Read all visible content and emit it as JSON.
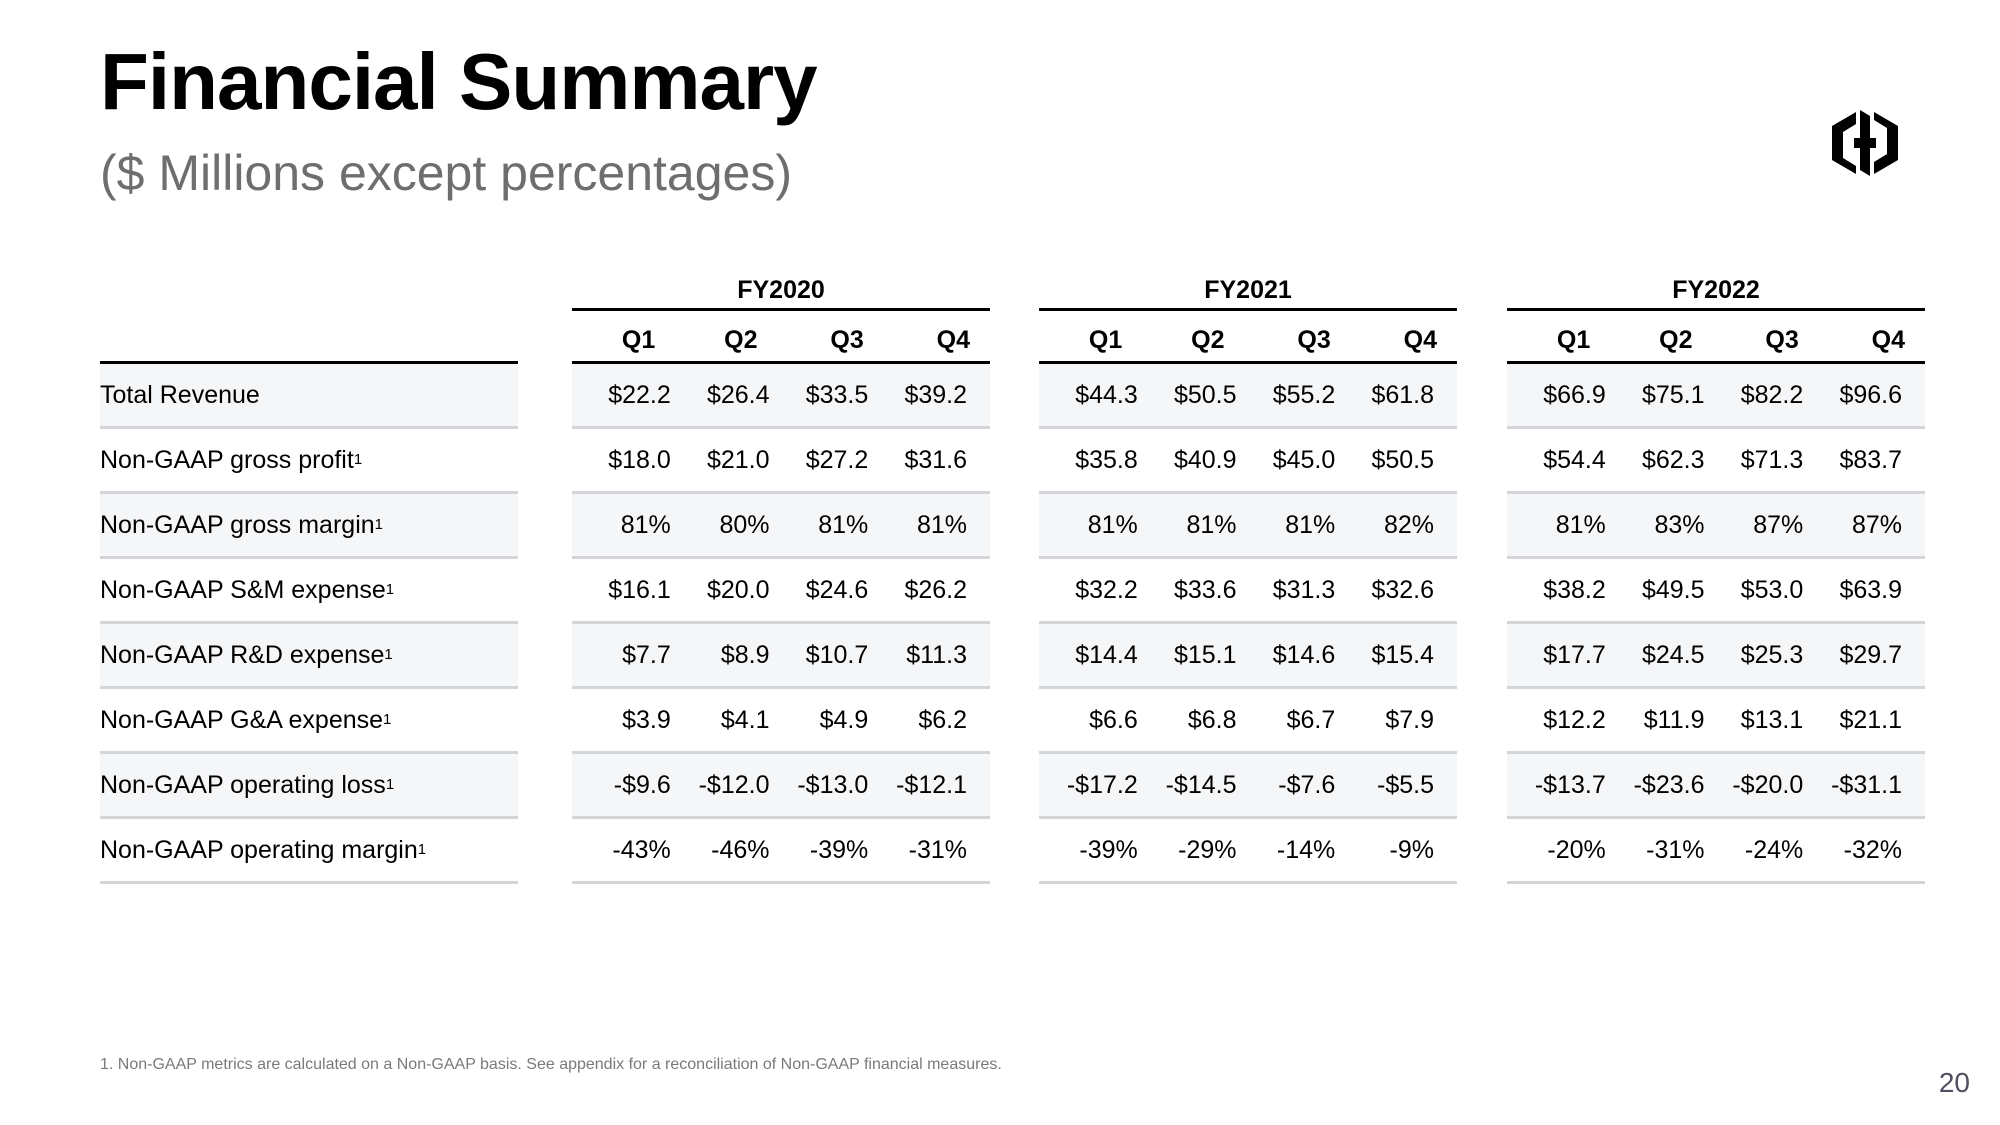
{
  "header": {
    "title": "Financial Summary",
    "subtitle": "($ Millions except percentages)",
    "logo": "hashicorp-logo-icon"
  },
  "table": {
    "row_labels": [
      {
        "label": "Total Revenue",
        "footnote": ""
      },
      {
        "label": "Non-GAAP gross profit",
        "footnote": "1"
      },
      {
        "label": "Non-GAAP gross margin",
        "footnote": "1"
      },
      {
        "label": "Non-GAAP S&M expense",
        "footnote": "1"
      },
      {
        "label": "Non-GAAP R&D expense",
        "footnote": "1"
      },
      {
        "label": "Non-GAAP G&A expense",
        "footnote": "1"
      },
      {
        "label": "Non-GAAP operating loss",
        "footnote": "1"
      },
      {
        "label": "Non-GAAP operating margin",
        "footnote": "1"
      }
    ],
    "quarters": [
      "Q1",
      "Q2",
      "Q3",
      "Q4"
    ],
    "fiscal_years": [
      {
        "name": "FY2020",
        "rows": [
          [
            "$22.2",
            "$26.4",
            "$33.5",
            "$39.2"
          ],
          [
            "$18.0",
            "$21.0",
            "$27.2",
            "$31.6"
          ],
          [
            "81%",
            "80%",
            "81%",
            "81%"
          ],
          [
            "$16.1",
            "$20.0",
            "$24.6",
            "$26.2"
          ],
          [
            "$7.7",
            "$8.9",
            "$10.7",
            "$11.3"
          ],
          [
            "$3.9",
            "$4.1",
            "$4.9",
            "$6.2"
          ],
          [
            "-$9.6",
            "-$12.0",
            "-$13.0",
            "-$12.1"
          ],
          [
            "-43%",
            "-46%",
            "-39%",
            "-31%"
          ]
        ]
      },
      {
        "name": "FY2021",
        "rows": [
          [
            "$44.3",
            "$50.5",
            "$55.2",
            "$61.8"
          ],
          [
            "$35.8",
            "$40.9",
            "$45.0",
            "$50.5"
          ],
          [
            "81%",
            "81%",
            "81%",
            "82%"
          ],
          [
            "$32.2",
            "$33.6",
            "$31.3",
            "$32.6"
          ],
          [
            "$14.4",
            "$15.1",
            "$14.6",
            "$15.4"
          ],
          [
            "$6.6",
            "$6.8",
            "$6.7",
            "$7.9"
          ],
          [
            "-$17.2",
            "-$14.5",
            "-$7.6",
            "-$5.5"
          ],
          [
            "-39%",
            "-29%",
            "-14%",
            "-9%"
          ]
        ]
      },
      {
        "name": "FY2022",
        "rows": [
          [
            "$66.9",
            "$75.1",
            "$82.2",
            "$96.6"
          ],
          [
            "$54.4",
            "$62.3",
            "$71.3",
            "$83.7"
          ],
          [
            "81%",
            "83%",
            "87%",
            "87%"
          ],
          [
            "$38.2",
            "$49.5",
            "$53.0",
            "$63.9"
          ],
          [
            "$17.7",
            "$24.5",
            "$25.3",
            "$29.7"
          ],
          [
            "$12.2",
            "$11.9",
            "$13.1",
            "$21.1"
          ],
          [
            "-$13.7",
            "-$23.6",
            "-$20.0",
            "-$31.1"
          ],
          [
            "-20%",
            "-31%",
            "-24%",
            "-32%"
          ]
        ]
      }
    ]
  },
  "footnote": "1. Non-GAAP metrics are calculated on a Non-GAAP basis. See appendix for a reconciliation of Non-GAAP financial measures.",
  "page_number": "20",
  "colors": {
    "row_shade": "#f5f6f8",
    "row_divider": "#d4d5d8",
    "subtitle": "#6e6e6e"
  }
}
